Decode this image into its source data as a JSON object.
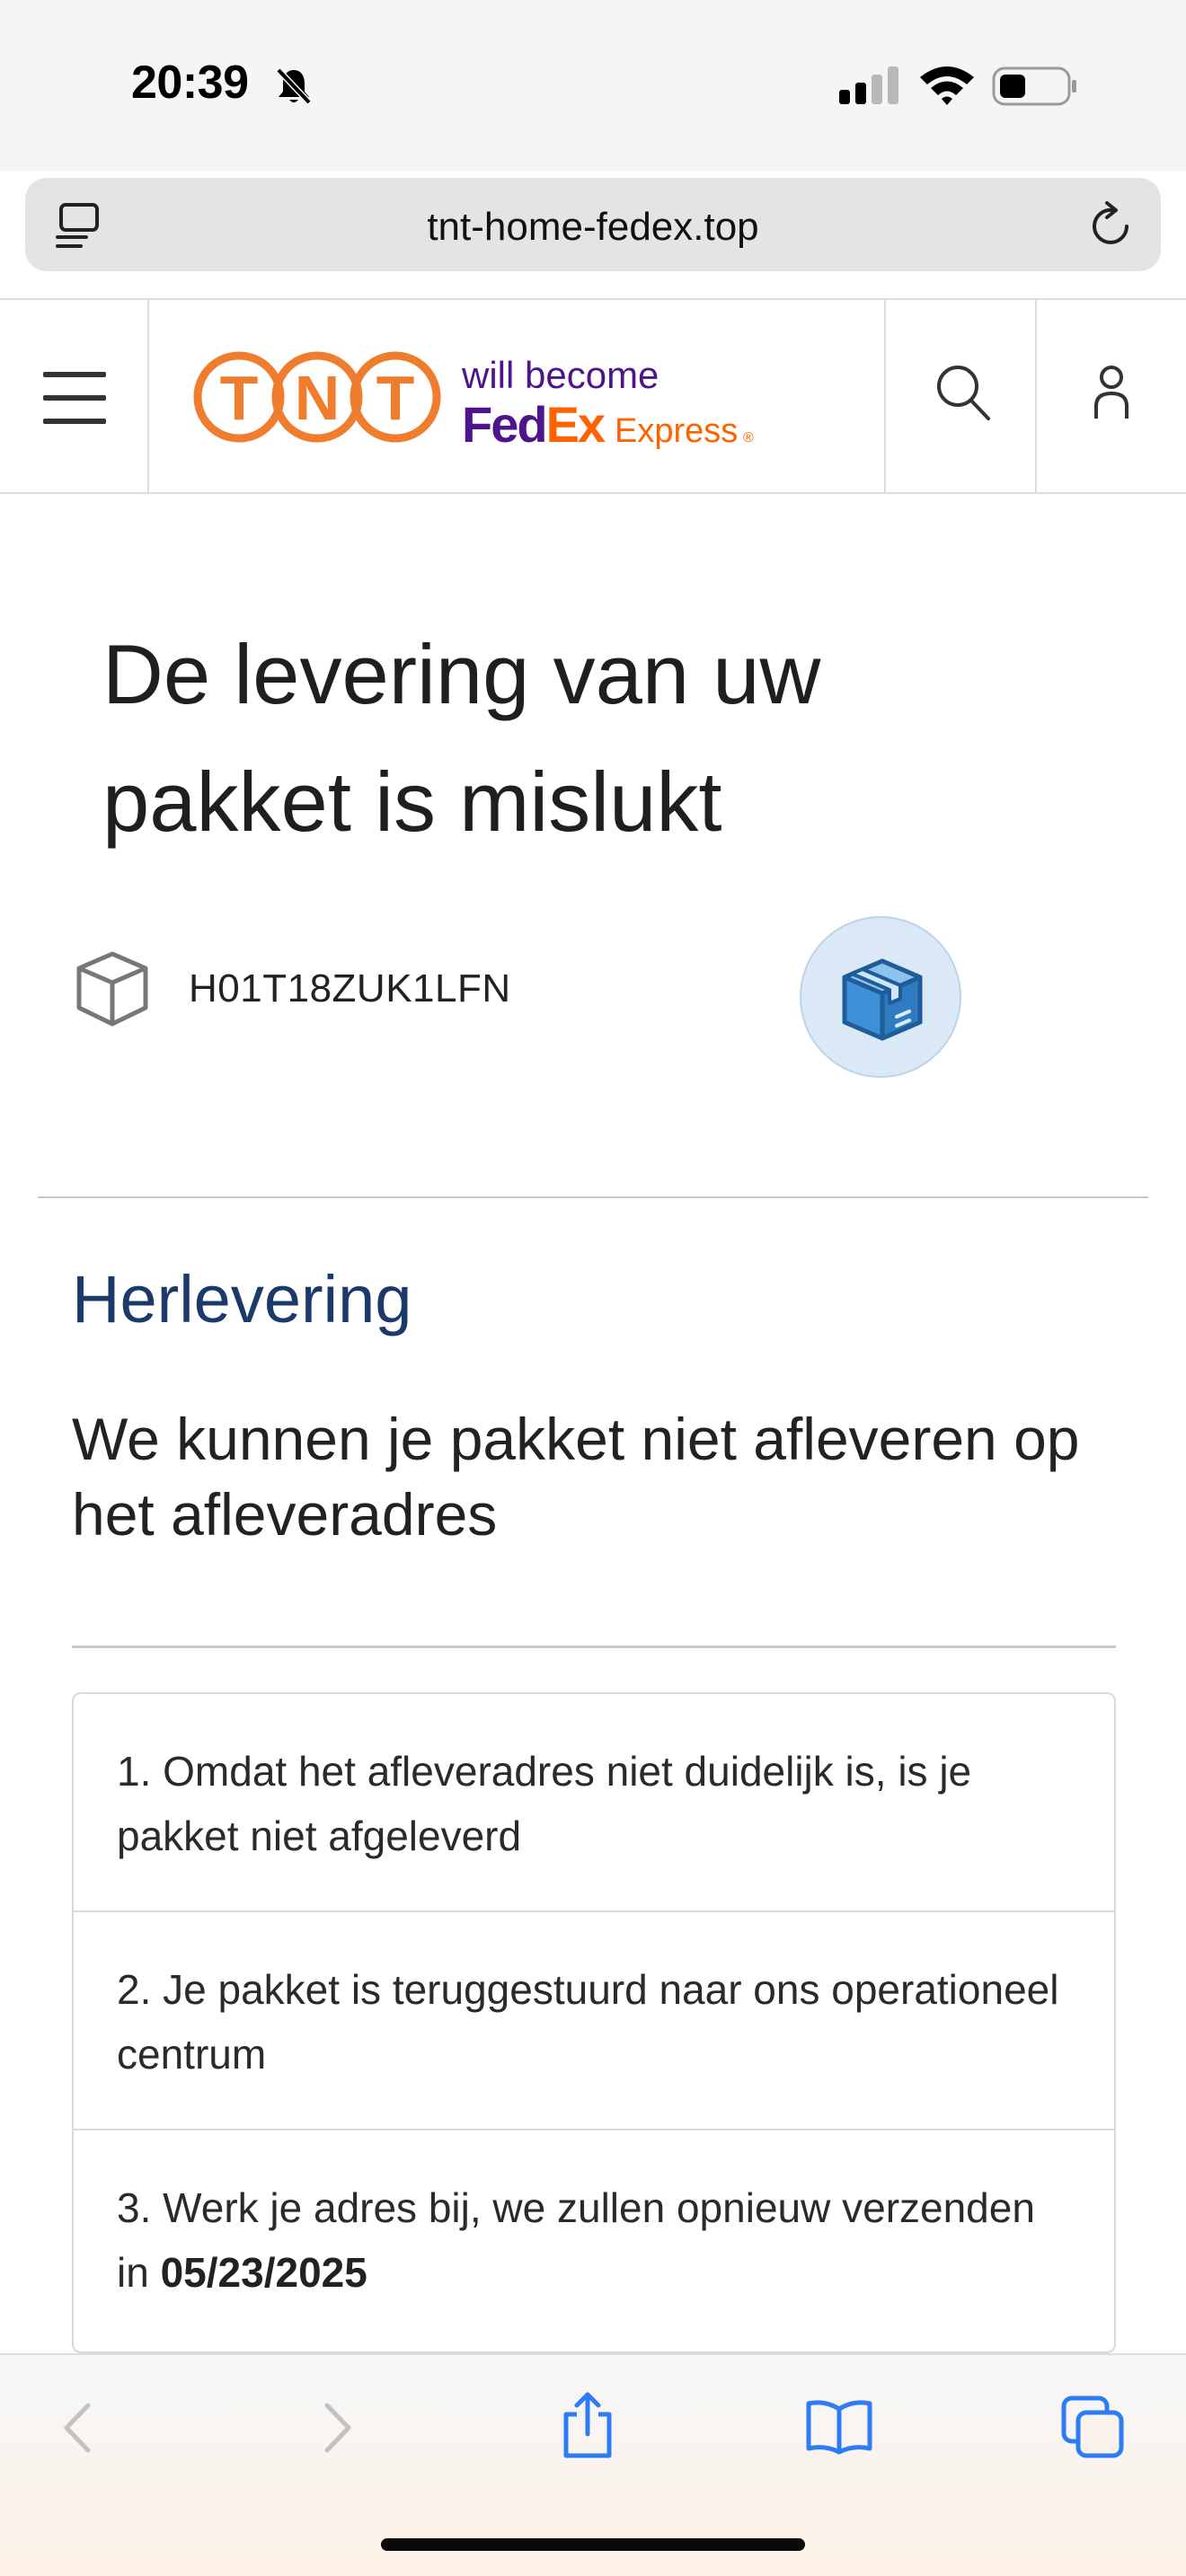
{
  "status_bar": {
    "time": "20:39",
    "icons": [
      "bell-slash-icon",
      "cellular-signal-icon",
      "wifi-icon",
      "battery-icon"
    ]
  },
  "browser": {
    "url": "tnt-home-fedex.top",
    "left_icon": "reader-mode-icon",
    "right_icon": "reload-icon"
  },
  "header": {
    "logo": {
      "tnt_letters": [
        "T",
        "N",
        "T"
      ],
      "tagline": "will become",
      "fedex_fed": "Fed",
      "fedex_ex": "Ex",
      "express": "Express",
      "registered": "®"
    },
    "icons": [
      "hamburger-menu-icon",
      "search-icon",
      "user-icon"
    ]
  },
  "main": {
    "title": "De levering van uw pakket is mislukt",
    "tracking_number": "H01T18ZUK1LFN",
    "section_heading": "Herlevering",
    "section_subheading": "We kunnen je pakket niet afleveren op het afleveradres",
    "steps": [
      {
        "text": "1. Omdat het afleveradres niet duidelijk is, is je pakket niet afgeleverd",
        "bold": ""
      },
      {
        "text": "2. Je pakket is teruggestuurd naar ons operationeel centrum",
        "bold": ""
      },
      {
        "text": "3. Werk je adres bij, we zullen opnieuw verzenden in ",
        "bold": "05/23/2025"
      }
    ]
  },
  "colors": {
    "tnt_orange": "#f07d2d",
    "fedex_purple": "#4d148c",
    "fedex_orange": "#ff6200",
    "heading_navy": "#1b3a6b",
    "safari_blue": "#2e7bf6"
  },
  "toolbar": {
    "icons": [
      "back-icon",
      "forward-icon",
      "share-icon",
      "bookmarks-icon",
      "tabs-icon"
    ]
  }
}
